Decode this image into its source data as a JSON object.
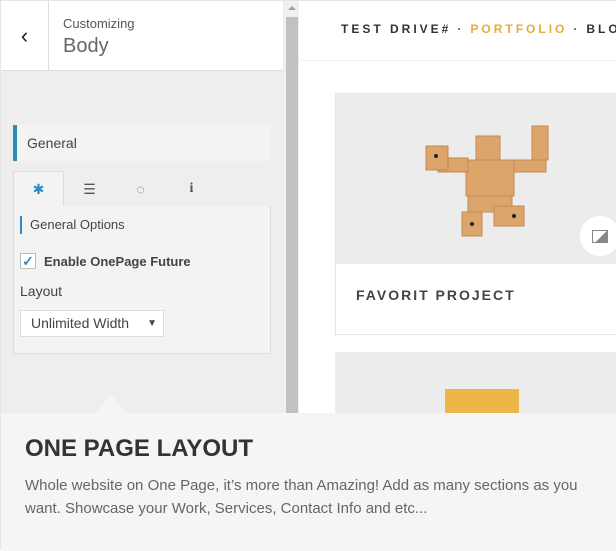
{
  "sidebar": {
    "back_label": "‹",
    "customizing": "Customizing",
    "section_title": "Body",
    "panel_title": "General",
    "tabs": [
      {
        "icon": "gear-icon",
        "glyph": "✱"
      },
      {
        "icon": "layout-icon",
        "glyph": "☰"
      },
      {
        "icon": "loading-icon",
        "glyph": "◌"
      },
      {
        "icon": "info-icon",
        "glyph": "i"
      }
    ],
    "group_title": "General Options",
    "checkbox_label": "Enable OnePage Future",
    "checkbox_checked": true,
    "layout_label": "Layout",
    "layout_value": "Unlimited Width"
  },
  "preview": {
    "nav": [
      "TEST DRIVE#",
      "PORTFOLIO",
      "BLOG"
    ],
    "nav_active": "PORTFOLIO",
    "card_title": "FAVORIT PROJECT"
  },
  "feature": {
    "title": "ONE PAGE LAYOUT",
    "description": "Whole website on One Page, it’s more than Amazing! Add as many sections as you want. Showcase your Work, Services, Contact Info and etc..."
  },
  "colors": {
    "accent": "#2e8bc0",
    "highlight": "#e9ab3c"
  }
}
